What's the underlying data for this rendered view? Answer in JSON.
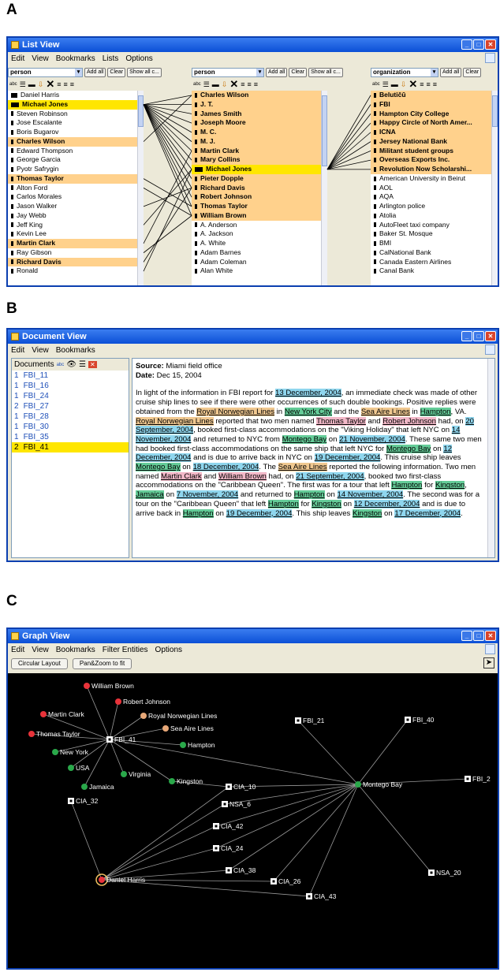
{
  "labels": {
    "a": "A",
    "b": "B",
    "c": "C"
  },
  "list_view": {
    "title": "List View",
    "menu": [
      "Edit",
      "View",
      "Bookmarks",
      "Lists",
      "Options"
    ],
    "col1": {
      "type": "person",
      "add": "Add all",
      "clear": "Clear",
      "show": "Show all c..."
    },
    "col2": {
      "type": "person",
      "add": "Add all",
      "clear": "Clear",
      "show": "Show all c..."
    },
    "col3": {
      "type": "organization",
      "add": "Add all",
      "clear": "Clear"
    },
    "list1": [
      {
        "t": "Daniel Harris",
        "s": "n"
      },
      {
        "t": "Michael Jones",
        "s": "y"
      },
      {
        "t": "Steven Robinson",
        "s": "n"
      },
      {
        "t": "Jose Escalante",
        "s": "n"
      },
      {
        "t": "Boris Bugarov",
        "s": "n"
      },
      {
        "t": "Charles Wilson",
        "s": "h"
      },
      {
        "t": "Edward Thompson",
        "s": "n"
      },
      {
        "t": "George Garcia",
        "s": "n"
      },
      {
        "t": "Pyotr Safrygin",
        "s": "n"
      },
      {
        "t": "Thomas Taylor",
        "s": "h"
      },
      {
        "t": "Alton Ford",
        "s": "n"
      },
      {
        "t": "Carlos Morales",
        "s": "n"
      },
      {
        "t": "Jason Walker",
        "s": "n"
      },
      {
        "t": "Jay Webb",
        "s": "n"
      },
      {
        "t": "Jeff King",
        "s": "n"
      },
      {
        "t": "Kevin Lee",
        "s": "n"
      },
      {
        "t": "Martin Clark",
        "s": "h"
      },
      {
        "t": "Ray Gibson",
        "s": "n"
      },
      {
        "t": "Richard Davis",
        "s": "h"
      },
      {
        "t": "Ronald",
        "s": "n"
      }
    ],
    "list2": [
      {
        "t": "Charles Wilson",
        "s": "h"
      },
      {
        "t": "J. T.",
        "s": "h"
      },
      {
        "t": "James Smith",
        "s": "h"
      },
      {
        "t": "Joseph Moore",
        "s": "h"
      },
      {
        "t": "M. C.",
        "s": "h"
      },
      {
        "t": "M. J.",
        "s": "h"
      },
      {
        "t": "Martin Clark",
        "s": "h"
      },
      {
        "t": "Mary Collins",
        "s": "h"
      },
      {
        "t": "Michael Jones",
        "s": "y"
      },
      {
        "t": "Pieter Dopple",
        "s": "h"
      },
      {
        "t": "Richard Davis",
        "s": "h"
      },
      {
        "t": "Robert Johnson",
        "s": "h"
      },
      {
        "t": "Thomas Taylor",
        "s": "h"
      },
      {
        "t": "William Brown",
        "s": "h"
      },
      {
        "t": "A. Anderson",
        "s": "n"
      },
      {
        "t": "A. Jackson",
        "s": "n"
      },
      {
        "t": "A. White",
        "s": "n"
      },
      {
        "t": "Adam Barnes",
        "s": "n"
      },
      {
        "t": "Adam Coleman",
        "s": "n"
      },
      {
        "t": "Alan White",
        "s": "n"
      }
    ],
    "list3": [
      {
        "t": "Belutičū",
        "s": "h"
      },
      {
        "t": "FBI",
        "s": "h"
      },
      {
        "t": "Hampton City College",
        "s": "h"
      },
      {
        "t": "Happy Circle of North Amer...",
        "s": "h"
      },
      {
        "t": "ICNA",
        "s": "h"
      },
      {
        "t": "Jersey National Bank",
        "s": "h"
      },
      {
        "t": "Militant student groups",
        "s": "h"
      },
      {
        "t": "Overseas Exports Inc.",
        "s": "h"
      },
      {
        "t": "Revolution Now Scholarshi...",
        "s": "h"
      },
      {
        "t": "American University in Beirut",
        "s": "n"
      },
      {
        "t": "AOL",
        "s": "n"
      },
      {
        "t": "AQA",
        "s": "n"
      },
      {
        "t": "Arlington police",
        "s": "n"
      },
      {
        "t": "Atolia",
        "s": "n"
      },
      {
        "t": "AutoFleet taxi company",
        "s": "n"
      },
      {
        "t": "Baker St. Mosque",
        "s": "n"
      },
      {
        "t": "BMI",
        "s": "n"
      },
      {
        "t": "CalNational Bank",
        "s": "n"
      },
      {
        "t": "Canada Eastern Airlines",
        "s": "n"
      },
      {
        "t": "Canal Bank",
        "s": "n"
      }
    ]
  },
  "doc_view": {
    "title": "Document View",
    "menu": [
      "Edit",
      "View",
      "Bookmarks"
    ],
    "docs_label": "Documents",
    "docs": [
      {
        "n": "1",
        "t": "FBI_11"
      },
      {
        "n": "1",
        "t": "FBI_16"
      },
      {
        "n": "1",
        "t": "FBI_24"
      },
      {
        "n": "2",
        "t": "FBI_27"
      },
      {
        "n": "1",
        "t": "FBI_28"
      },
      {
        "n": "1",
        "t": "FBI_30"
      },
      {
        "n": "1",
        "t": "FBI_35"
      },
      {
        "n": "2",
        "t": "FBI_41"
      }
    ],
    "source_label": "Source:",
    "source": " Miami field office",
    "date_label": "Date:",
    "date": " Dec 15, 2004",
    "body": [
      [
        "",
        "In light of the information in FBI report for "
      ],
      [
        "d",
        "13 December, 2004"
      ],
      [
        "",
        ", an immediate check was made of other cruise ship lines to see if there were other occurrences of such double bookings. Positive replies were obtained from the "
      ],
      [
        "o",
        "Royal Norwegian Lines"
      ],
      [
        "",
        " in "
      ],
      [
        "p",
        "New York City"
      ],
      [
        "",
        " and the "
      ],
      [
        "o",
        "Sea Aire Lines"
      ],
      [
        "",
        " in "
      ],
      [
        "p",
        "Hampton"
      ],
      [
        "",
        ", VA. "
      ],
      [
        "o",
        "Royal Norwegian Lines"
      ],
      [
        "",
        " reported that two men named "
      ],
      [
        "r",
        "Thomas Taylor"
      ],
      [
        "",
        " and "
      ],
      [
        "r",
        "Robert Johnson"
      ],
      [
        "",
        " had, on "
      ],
      [
        "d",
        "20 September, 2004"
      ],
      [
        "",
        ", booked first-class accommodations on the \"Viking Holiday\" that left NYC on "
      ],
      [
        "d",
        "14 November, 2004"
      ],
      [
        "",
        " and returned to NYC from "
      ],
      [
        "p",
        "Montego Bay"
      ],
      [
        "",
        " on "
      ],
      [
        "d",
        "21 November, 2004"
      ],
      [
        "",
        ". These same two men had booked first-class accommodations on the same ship that left NYC for "
      ],
      [
        "p",
        "Montego Bay"
      ],
      [
        "",
        " on "
      ],
      [
        "d",
        "12 December, 2004"
      ],
      [
        "",
        " and is due to arrive back in NYC on "
      ],
      [
        "d",
        "19 December, 2004"
      ],
      [
        "",
        ". This cruise ship leaves "
      ],
      [
        "p",
        "Montego Bay"
      ],
      [
        "",
        " on "
      ],
      [
        "d",
        "18 December, 2004"
      ],
      [
        "",
        ". The "
      ],
      [
        "o",
        "Sea Aire Lines"
      ],
      [
        "",
        " reported the following information. Two men named "
      ],
      [
        "r",
        "Martin Clark"
      ],
      [
        "",
        " and "
      ],
      [
        "r",
        "William Brown"
      ],
      [
        "",
        " had, on "
      ],
      [
        "d",
        "21 September, 2004"
      ],
      [
        "",
        ", booked two first-class accommodations on the \"Caribbean Queen\". The first was for a tour that left "
      ],
      [
        "p",
        "Hampton"
      ],
      [
        "",
        " for "
      ],
      [
        "p",
        "Kingston"
      ],
      [
        "",
        ", "
      ],
      [
        "p",
        "Jamaica"
      ],
      [
        "",
        " on "
      ],
      [
        "d",
        "7 November, 2004"
      ],
      [
        "",
        " and returned to "
      ],
      [
        "p",
        "Hampton"
      ],
      [
        "",
        " on "
      ],
      [
        "d",
        "14 November, 2004"
      ],
      [
        "",
        ". The second was for a tour on the \"Caribbean Queen\" that left "
      ],
      [
        "p",
        "Hampton"
      ],
      [
        "",
        " for "
      ],
      [
        "p",
        "Kingston"
      ],
      [
        "",
        " on "
      ],
      [
        "d",
        "12 December, 2004"
      ],
      [
        "",
        " and is due to arrive back in "
      ],
      [
        "p",
        "Hampton"
      ],
      [
        "",
        " on "
      ],
      [
        "d",
        "19 December, 2004"
      ],
      [
        "",
        ". This ship leaves "
      ],
      [
        "p",
        "Kingston"
      ],
      [
        "",
        " on "
      ],
      [
        "d",
        "17 December, 2004"
      ],
      [
        "",
        "."
      ]
    ]
  },
  "graph_view": {
    "title": "Graph View",
    "menu": [
      "Edit",
      "View",
      "Bookmarks",
      "Filter Entities",
      "Options"
    ],
    "btn_circular": "Circular Layout",
    "btn_fit": "Pan&Zoom to fit",
    "colors": {
      "person": "#e8333a",
      "org": "#e8a878",
      "place": "#2aa84a",
      "doc": "#ffffff",
      "edge": "#9a9a9a"
    },
    "nodes": [
      {
        "id": "wb",
        "label": "William Brown",
        "kind": "person"
      },
      {
        "id": "rj",
        "label": "Robert Johnson",
        "kind": "person"
      },
      {
        "id": "mc",
        "label": "Martin Clark",
        "kind": "person"
      },
      {
        "id": "rnl",
        "label": "Royal Norwegian Lines",
        "kind": "org"
      },
      {
        "id": "sal",
        "label": "Sea Aire Lines",
        "kind": "org"
      },
      {
        "id": "tt",
        "label": "Thomas Taylor",
        "kind": "person"
      },
      {
        "id": "f41",
        "label": "FBI_41",
        "kind": "doc"
      },
      {
        "id": "ham",
        "label": "Hampton",
        "kind": "place"
      },
      {
        "id": "ny",
        "label": "New York",
        "kind": "place"
      },
      {
        "id": "usa",
        "label": "USA",
        "kind": "place"
      },
      {
        "id": "vir",
        "label": "Virginia",
        "kind": "place"
      },
      {
        "id": "kin",
        "label": "Kingston",
        "kind": "place"
      },
      {
        "id": "jam",
        "label": "Jamaica",
        "kind": "place"
      },
      {
        "id": "f21",
        "label": "FBI_21",
        "kind": "doc"
      },
      {
        "id": "f40",
        "label": "FBI_40",
        "kind": "doc"
      },
      {
        "id": "f2",
        "label": "FBI_2",
        "kind": "doc"
      },
      {
        "id": "mb",
        "label": "Montego Bay",
        "kind": "place"
      },
      {
        "id": "c32",
        "label": "CIA_32",
        "kind": "doc"
      },
      {
        "id": "c10",
        "label": "CIA_10",
        "kind": "doc"
      },
      {
        "id": "n6",
        "label": "NSA_6",
        "kind": "doc"
      },
      {
        "id": "c42",
        "label": "CIA_42",
        "kind": "doc"
      },
      {
        "id": "c24",
        "label": "CIA_24",
        "kind": "doc"
      },
      {
        "id": "c38",
        "label": "CIA_38",
        "kind": "doc"
      },
      {
        "id": "c26",
        "label": "CIA_26",
        "kind": "doc"
      },
      {
        "id": "c43",
        "label": "CIA_43",
        "kind": "doc"
      },
      {
        "id": "n20",
        "label": "NSA_20",
        "kind": "doc"
      },
      {
        "id": "dh",
        "label": "Daniel Harris",
        "kind": "person"
      }
    ],
    "edges": [
      [
        "f41",
        "wb"
      ],
      [
        "f41",
        "rj"
      ],
      [
        "f41",
        "mc"
      ],
      [
        "f41",
        "rnl"
      ],
      [
        "f41",
        "sal"
      ],
      [
        "f41",
        "tt"
      ],
      [
        "f41",
        "ham"
      ],
      [
        "f41",
        "ny"
      ],
      [
        "f41",
        "usa"
      ],
      [
        "f41",
        "vir"
      ],
      [
        "f41",
        "kin"
      ],
      [
        "f41",
        "jam"
      ],
      [
        "f41",
        "mb"
      ],
      [
        "kin",
        "c10"
      ],
      [
        "mb",
        "f21"
      ],
      [
        "mb",
        "f40"
      ],
      [
        "mb",
        "f2"
      ],
      [
        "mb",
        "c10"
      ],
      [
        "mb",
        "n6"
      ],
      [
        "mb",
        "c42"
      ],
      [
        "mb",
        "c24"
      ],
      [
        "mb",
        "c38"
      ],
      [
        "mb",
        "c26"
      ],
      [
        "mb",
        "c43"
      ],
      [
        "mb",
        "n20"
      ],
      [
        "dh",
        "c10"
      ],
      [
        "dh",
        "n6"
      ],
      [
        "dh",
        "c42"
      ],
      [
        "dh",
        "c24"
      ],
      [
        "dh",
        "c38"
      ],
      [
        "dh",
        "c26"
      ],
      [
        "dh",
        "c43"
      ],
      [
        "dh",
        "c32"
      ]
    ]
  }
}
